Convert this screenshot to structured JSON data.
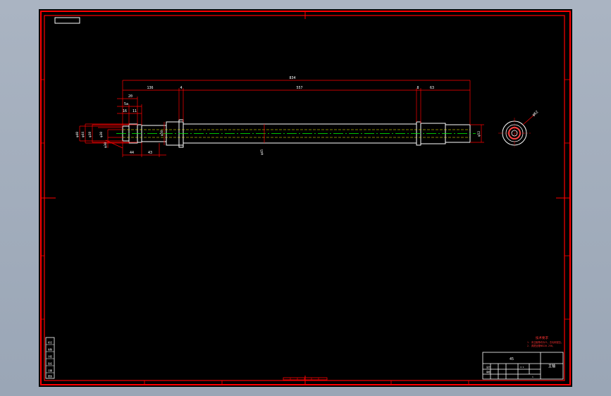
{
  "colors": {
    "background": "#000000",
    "border": "#ff0000",
    "outline": "#ffffff",
    "centerline": "#00ff00",
    "window": "#a5b0bf"
  },
  "dimensions": {
    "overall_length": "834",
    "seg_136": "136",
    "seg_4a": "4",
    "seg_557": "557",
    "seg_8": "8",
    "seg_63": "63",
    "seg_20": "20",
    "seg_5a": "5a",
    "seg_16": "16",
    "seg_11": "11",
    "seg_44": "44",
    "seg_43": "43",
    "dia_40": "φ40",
    "dia_44": "φ44",
    "dia_38": "φ38",
    "dia_30": "φ30",
    "dia_30b": "φ30",
    "dia_50": "φ50",
    "dia_45": "φ45",
    "dia_52": "φ52",
    "section_dia": "φ62"
  },
  "notes": {
    "heading": "技术要求",
    "line1": "1. 未注倒角均为C1，去毛刺锐边。",
    "line2": "2. 调质处理HB220-250。"
  },
  "title_block": {
    "part_name": "主轴",
    "material": "45",
    "scale": "1:1",
    "designer": "设计",
    "checker": "审核",
    "sheet": "1"
  },
  "revision_block": {
    "rows": [
      "标记",
      "处数",
      "分区",
      "签名",
      "日期",
      "更改"
    ]
  }
}
